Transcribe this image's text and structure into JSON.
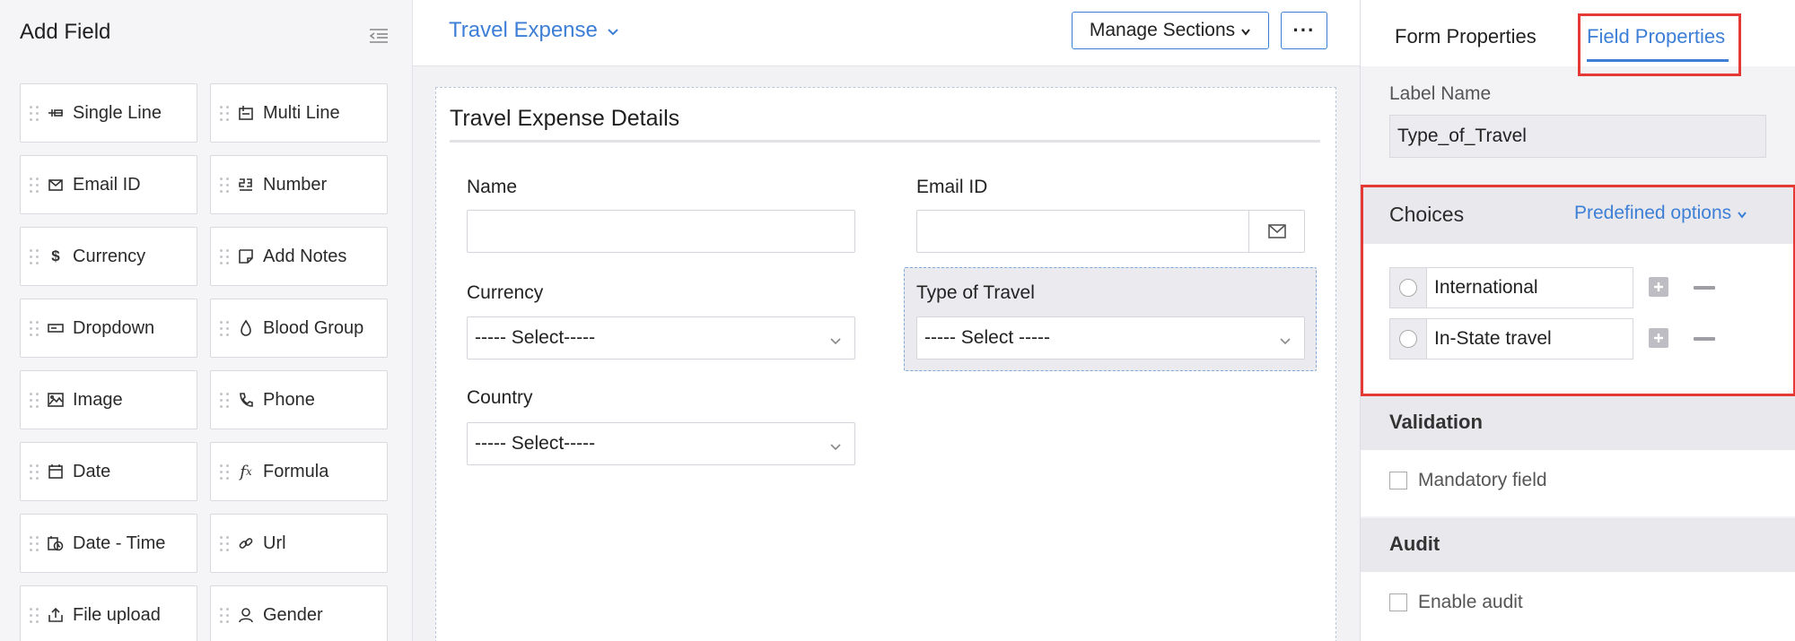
{
  "left_panel": {
    "title": "Add Field",
    "fields": [
      {
        "label": "Single Line",
        "icon": "single-line-icon"
      },
      {
        "label": "Multi Line",
        "icon": "multi-line-icon"
      },
      {
        "label": "Email ID",
        "icon": "envelope-icon"
      },
      {
        "label": "Number",
        "icon": "number-icon"
      },
      {
        "label": "Currency",
        "icon": "dollar-icon"
      },
      {
        "label": "Add Notes",
        "icon": "note-icon"
      },
      {
        "label": "Dropdown",
        "icon": "dropdown-icon"
      },
      {
        "label": "Blood Group",
        "icon": "drop-icon"
      },
      {
        "label": "Image",
        "icon": "image-icon"
      },
      {
        "label": "Phone",
        "icon": "phone-icon"
      },
      {
        "label": "Date",
        "icon": "calendar-icon"
      },
      {
        "label": "Formula",
        "icon": "formula-icon"
      },
      {
        "label": "Date - Time",
        "icon": "datetime-icon"
      },
      {
        "label": "Url",
        "icon": "link-icon"
      },
      {
        "label": "File upload",
        "icon": "upload-icon"
      },
      {
        "label": "Gender",
        "icon": "person-icon"
      }
    ]
  },
  "center": {
    "form_name": "Travel Expense",
    "manage_sections_label": "Manage Sections",
    "more_label": "···",
    "section_title": "Travel Expense Details",
    "fields": {
      "name_label": "Name",
      "email_label": "Email ID",
      "currency_label": "Currency",
      "currency_value": "----- Select-----",
      "type_label": "Type of Travel",
      "type_value": "----- Select -----",
      "country_label": "Country",
      "country_value": "----- Select-----"
    }
  },
  "right_panel": {
    "tabs": {
      "form_properties": "Form Properties",
      "field_properties": "Field Properties"
    },
    "label_name_title": "Label Name",
    "label_name_value": "Type_of_Travel",
    "choices_title": "Choices",
    "predefined_options": "Predefined options",
    "choices": [
      "International",
      "In-State travel"
    ],
    "validation_title": "Validation",
    "mandatory_label": "Mandatory field",
    "audit_title": "Audit",
    "audit_label": "Enable audit"
  },
  "colors": {
    "accent": "#3d7fd6",
    "highlight": "#e53935"
  }
}
